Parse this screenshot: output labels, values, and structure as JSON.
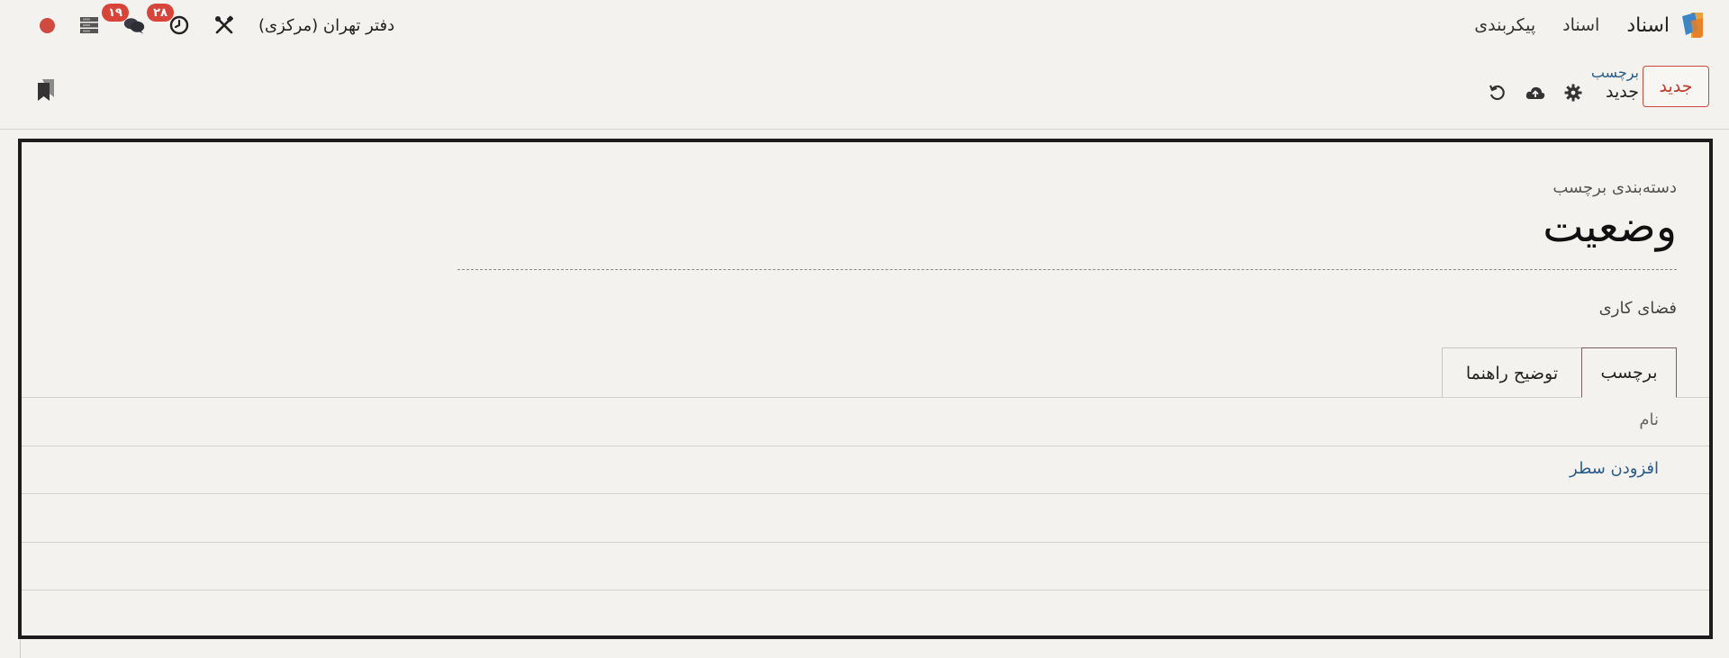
{
  "navbar": {
    "app_name": "اسناد",
    "menu": [
      "اسناد",
      "پیکربندی"
    ],
    "company": "دفتر تهران (مرکزی)",
    "messages_badge": "۱۹",
    "activities_badge": "۲۸",
    "icons": [
      "app-logo",
      "debug-tools-icon",
      "clock-icon",
      "chat-icon",
      "server-icon",
      "status-dot"
    ],
    "status_color": "#cf4a3f"
  },
  "control": {
    "new_button": "جدید",
    "breadcrumb_parent": "برچسب",
    "breadcrumb_current": "جدید"
  },
  "form": {
    "category_label": "دسته‌بندی برچسب",
    "title": "وضعیت",
    "workspace_label": "فضای کاری",
    "tabs": [
      "برچسب",
      "توضیح راهنما"
    ],
    "list": {
      "column_name": "نام",
      "add_line": "افزودن سطر"
    }
  },
  "colors": {
    "accent": "#c0392b",
    "link": "#2a5c8a",
    "background": "#f3f2ee"
  }
}
